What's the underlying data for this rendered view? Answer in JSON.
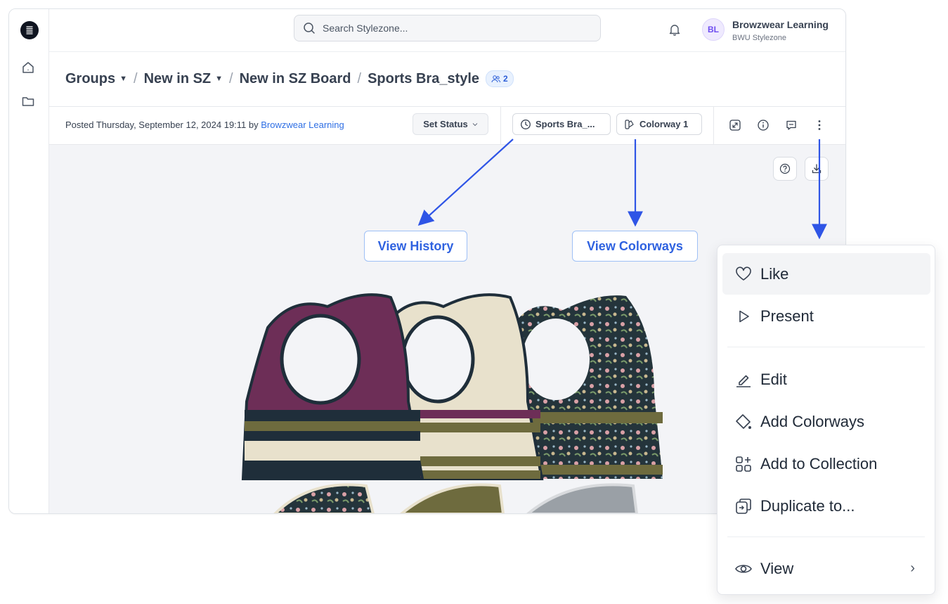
{
  "search": {
    "placeholder": "Search Stylezone..."
  },
  "user": {
    "initials": "BL",
    "name": "Browzwear Learning",
    "org": "BWU Stylezone"
  },
  "breadcrumb": {
    "items": [
      {
        "label": "Groups",
        "dropdown": true
      },
      {
        "label": "New in SZ",
        "dropdown": true
      },
      {
        "label": "New in SZ Board",
        "dropdown": false
      },
      {
        "label": "Sports Bra_style",
        "dropdown": false
      }
    ],
    "separator": "/",
    "members_count": "2"
  },
  "post": {
    "prefix": "Posted Thursday, September 12, 2024 19:11 by ",
    "author": "Browzwear Learning",
    "set_status": "Set Status",
    "version_label": "Sports Bra_...",
    "colorway_label": "Colorway 1"
  },
  "callouts": {
    "history": "View History",
    "colorways": "View Colorways"
  },
  "menu": {
    "items": [
      {
        "label": "Like",
        "icon": "heart-icon"
      },
      {
        "label": "Present",
        "icon": "play-icon"
      },
      {
        "label": "Edit",
        "icon": "pencil-icon"
      },
      {
        "label": "Add Colorways",
        "icon": "paint-bucket-icon"
      },
      {
        "label": "Add to Collection",
        "icon": "grid-plus-icon"
      },
      {
        "label": "Duplicate to...",
        "icon": "duplicate-icon"
      },
      {
        "label": "View",
        "icon": "eye-icon"
      }
    ],
    "chevron": "›"
  },
  "colors": {
    "accent": "#2f62e0",
    "arrow": "#2f55e6",
    "plum": "#6d2e57",
    "cream": "#e8e1cc",
    "olive": "#6e6b3e",
    "navy": "#1f2e3a",
    "floral": "#24343b"
  }
}
